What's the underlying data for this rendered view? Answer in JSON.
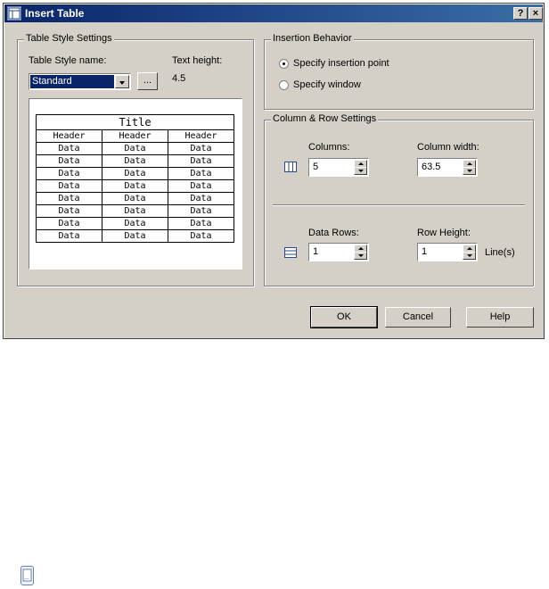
{
  "window": {
    "title": "Insert Table",
    "help_glyph": "?",
    "close_glyph": "×"
  },
  "table_style": {
    "group_label": "Table Style Settings",
    "name_label": "Table Style name:",
    "selected_style": "Standard",
    "browse_label": "...",
    "text_height_label": "Text height:",
    "text_height_value": "4.5",
    "preview": {
      "title": "Title",
      "headers": [
        "Header",
        "Header",
        "Header"
      ],
      "cell": "Data",
      "data_rows": 8
    }
  },
  "insertion": {
    "group_label": "Insertion Behavior",
    "point_label": "Specify insertion point",
    "window_label": "Specify window",
    "selected": "point"
  },
  "colrow": {
    "group_label": "Column & Row Settings",
    "columns_label": "Columns:",
    "columns_value": "5",
    "column_width_label": "Column width:",
    "column_width_value": "63.5",
    "data_rows_label": "Data Rows:",
    "data_rows_value": "1",
    "row_height_label": "Row Height:",
    "row_height_value": "1",
    "row_height_unit": "Line(s)"
  },
  "buttons": {
    "ok": "OK",
    "cancel": "Cancel",
    "help": "Help"
  },
  "icons": {
    "app": "table-app-icon",
    "columns": "columns-icon",
    "rows": "rows-icon",
    "taskbar": "window-icon"
  }
}
